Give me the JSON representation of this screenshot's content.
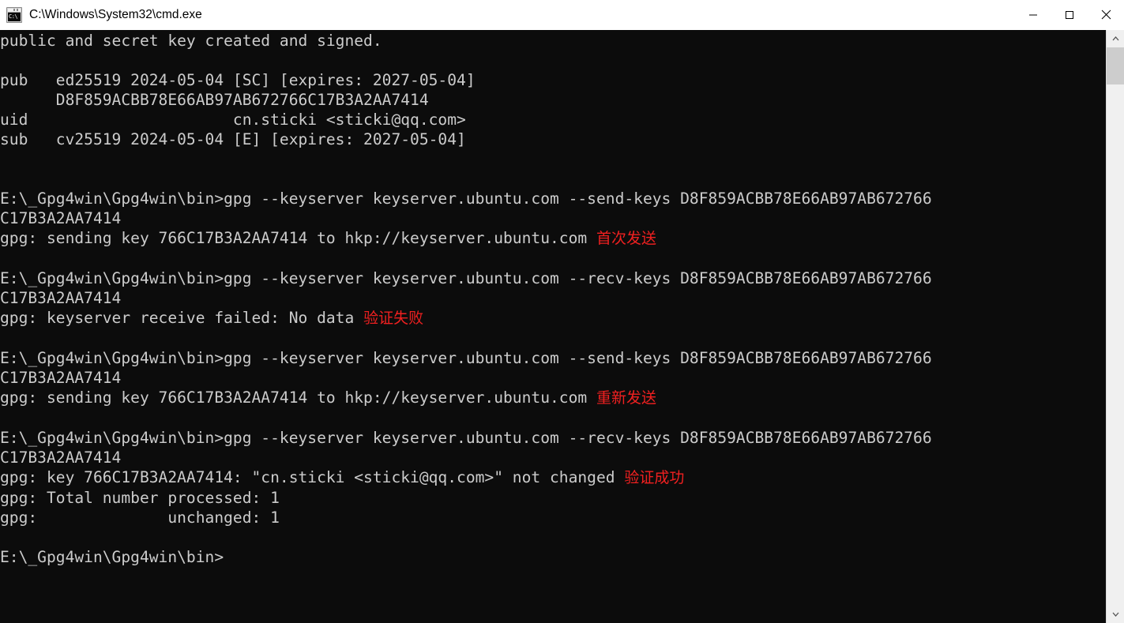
{
  "window": {
    "title": "C:\\Windows\\System32\\cmd.exe",
    "icon": "cmd-console-icon",
    "icon_glyph": "C:\\",
    "background_color": "#0c0c0c",
    "text_color": "#cccccc",
    "annotation_color": "#f02020",
    "titlebar_color": "#ffffff"
  },
  "controls": {
    "minimize_label": "Minimize",
    "maximize_label": "Maximize",
    "close_label": "Close"
  },
  "scrollbar": {
    "up_arrow": "scroll-up-arrow",
    "down_arrow": "scroll-down-arrow",
    "thumb": "scrollbar-thumb"
  },
  "terminal": {
    "prompt": "E:\\_Gpg4win\\Gpg4win\\bin>",
    "key_fingerprint": "D8F859ACBB78E66AB97AB672766C17B3A2AA7414",
    "key_id": "766C17B3A2AA7414",
    "uid": "cn.sticki <sticki@qq.com>",
    "keyserver": "keyserver.ubuntu.com",
    "content": "public and secret key created and signed.\n\npub   ed25519 2024-05-04 [SC] [expires: 2027-05-04]\n      D8F859ACBB78E66AB97AB672766C17B3A2AA7414\nuid                      cn.sticki <sticki@qq.com>\nsub   cv25519 2024-05-04 [E] [expires: 2027-05-04]\n\n\nE:\\_Gpg4win\\Gpg4win\\bin>gpg --keyserver keyserver.ubuntu.com --send-keys D8F859ACBB78E66AB97AB672766\nC17B3A2AA7414\ngpg: sending key 766C17B3A2AA7414 to hkp://keyserver.ubuntu.com ",
    "lines": [
      {
        "text": "public and secret key created and signed.",
        "annotation": ""
      },
      {
        "text": "",
        "annotation": ""
      },
      {
        "text": "pub   ed25519 2024-05-04 [SC] [expires: 2027-05-04]",
        "annotation": ""
      },
      {
        "text": "      D8F859ACBB78E66AB97AB672766C17B3A2AA7414",
        "annotation": ""
      },
      {
        "text": "uid                      cn.sticki <sticki@qq.com>",
        "annotation": ""
      },
      {
        "text": "sub   cv25519 2024-05-04 [E] [expires: 2027-05-04]",
        "annotation": ""
      },
      {
        "text": "",
        "annotation": ""
      },
      {
        "text": "",
        "annotation": ""
      },
      {
        "text": "E:\\_Gpg4win\\Gpg4win\\bin>gpg --keyserver keyserver.ubuntu.com --send-keys D8F859ACBB78E66AB97AB672766",
        "annotation": ""
      },
      {
        "text": "C17B3A2AA7414",
        "annotation": ""
      },
      {
        "text": "gpg: sending key 766C17B3A2AA7414 to hkp://keyserver.ubuntu.com ",
        "annotation": "首次发送"
      },
      {
        "text": "",
        "annotation": ""
      },
      {
        "text": "E:\\_Gpg4win\\Gpg4win\\bin>gpg --keyserver keyserver.ubuntu.com --recv-keys D8F859ACBB78E66AB97AB672766",
        "annotation": ""
      },
      {
        "text": "C17B3A2AA7414",
        "annotation": ""
      },
      {
        "text": "gpg: keyserver receive failed: No data ",
        "annotation": "验证失败"
      },
      {
        "text": "",
        "annotation": ""
      },
      {
        "text": "E:\\_Gpg4win\\Gpg4win\\bin>gpg --keyserver keyserver.ubuntu.com --send-keys D8F859ACBB78E66AB97AB672766",
        "annotation": ""
      },
      {
        "text": "C17B3A2AA7414",
        "annotation": ""
      },
      {
        "text": "gpg: sending key 766C17B3A2AA7414 to hkp://keyserver.ubuntu.com ",
        "annotation": "重新发送"
      },
      {
        "text": "",
        "annotation": ""
      },
      {
        "text": "E:\\_Gpg4win\\Gpg4win\\bin>gpg --keyserver keyserver.ubuntu.com --recv-keys D8F859ACBB78E66AB97AB672766",
        "annotation": ""
      },
      {
        "text": "C17B3A2AA7414",
        "annotation": ""
      },
      {
        "text": "gpg: key 766C17B3A2AA7414: \"cn.sticki <sticki@qq.com>\" not changed ",
        "annotation": "验证成功"
      },
      {
        "text": "gpg: Total number processed: 1",
        "annotation": ""
      },
      {
        "text": "gpg:              unchanged: 1",
        "annotation": ""
      },
      {
        "text": "",
        "annotation": ""
      },
      {
        "text": "E:\\_Gpg4win\\Gpg4win\\bin>",
        "annotation": ""
      }
    ]
  }
}
